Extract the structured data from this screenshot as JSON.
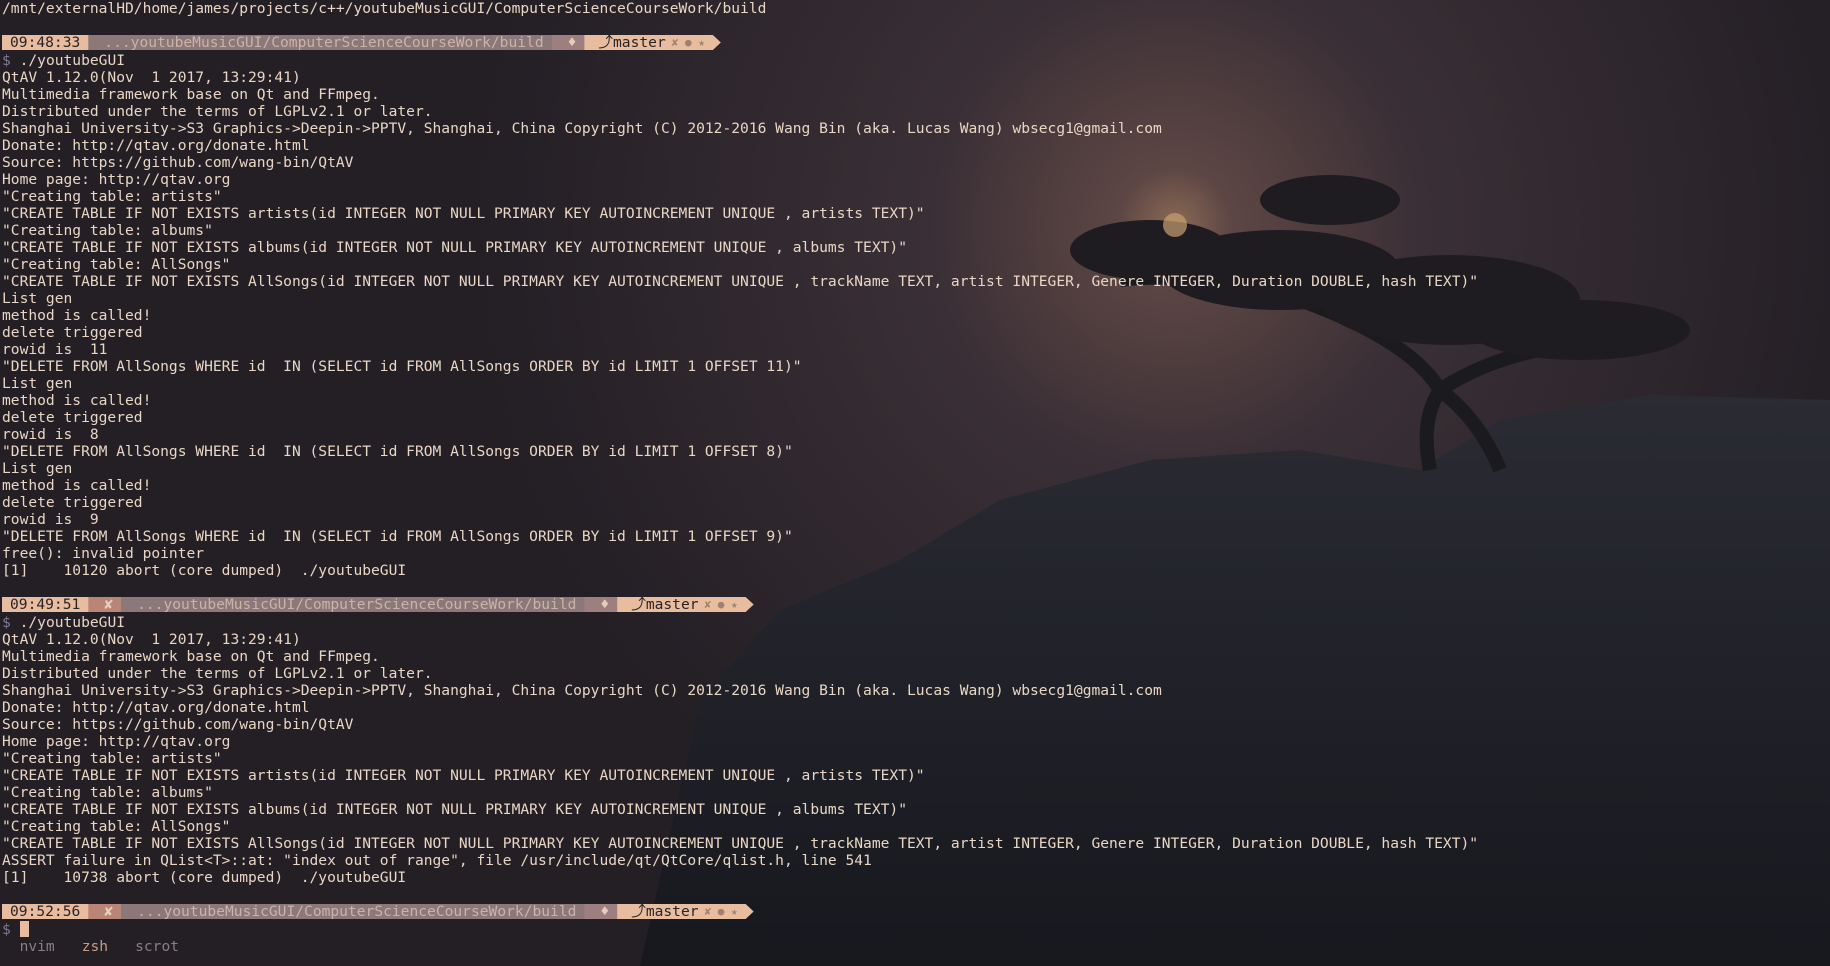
{
  "terminal": {
    "cwd_line": "/mnt/externalHD/home/james/projects/c++/youtubeMusicGUI/ComputerScienceCourseWork/build",
    "prompts": [
      {
        "time": "09:48:33",
        "error": "",
        "path": "...youtubeMusicGUI/ComputerScienceCourseWork/build",
        "dirty": "♦",
        "branch_icon": "⤴",
        "branch": "master",
        "git_status": "✘ ● ★",
        "command": "./youtubeGUI"
      },
      {
        "time": "09:49:51",
        "error": "✘",
        "path": "...youtubeMusicGUI/ComputerScienceCourseWork/build",
        "dirty": "♦",
        "branch_icon": "⤴",
        "branch": "master",
        "git_status": "✘ ● ★",
        "command": "./youtubeGUI"
      },
      {
        "time": "09:52:56",
        "error": "✘",
        "path": "...youtubeMusicGUI/ComputerScienceCourseWork/build",
        "dirty": "♦",
        "branch_icon": "⤴",
        "branch": "master",
        "git_status": "✘ ● ★",
        "command": ""
      }
    ],
    "prompt_symbol": "$",
    "outputs": [
      [
        "QtAV 1.12.0(Nov  1 2017, 13:29:41)",
        "Multimedia framework base on Qt and FFmpeg.",
        "Distributed under the terms of LGPLv2.1 or later.",
        "Shanghai University->S3 Graphics->Deepin->PPTV, Shanghai, China Copyright (C) 2012-2016 Wang Bin (aka. Lucas Wang) wbsecg1@gmail.com",
        "Donate: http://qtav.org/donate.html",
        "Source: https://github.com/wang-bin/QtAV",
        "Home page: http://qtav.org",
        "\"Creating table: artists\"",
        "\"CREATE TABLE IF NOT EXISTS artists(id INTEGER NOT NULL PRIMARY KEY AUTOINCREMENT UNIQUE , artists TEXT)\"",
        "\"Creating table: albums\"",
        "\"CREATE TABLE IF NOT EXISTS albums(id INTEGER NOT NULL PRIMARY KEY AUTOINCREMENT UNIQUE , albums TEXT)\"",
        "\"Creating table: AllSongs\"",
        "\"CREATE TABLE IF NOT EXISTS AllSongs(id INTEGER NOT NULL PRIMARY KEY AUTOINCREMENT UNIQUE , trackName TEXT, artist INTEGER, Genere INTEGER, Duration DOUBLE, hash TEXT)\"",
        "List gen",
        "method is called!",
        "delete triggered",
        "rowid is  11",
        "\"DELETE FROM AllSongs WHERE id  IN (SELECT id FROM AllSongs ORDER BY id LIMIT 1 OFFSET 11)\"",
        "List gen",
        "method is called!",
        "delete triggered",
        "rowid is  8",
        "\"DELETE FROM AllSongs WHERE id  IN (SELECT id FROM AllSongs ORDER BY id LIMIT 1 OFFSET 8)\"",
        "List gen",
        "method is called!",
        "delete triggered",
        "rowid is  9",
        "\"DELETE FROM AllSongs WHERE id  IN (SELECT id FROM AllSongs ORDER BY id LIMIT 1 OFFSET 9)\"",
        "free(): invalid pointer",
        "[1]    10120 abort (core dumped)  ./youtubeGUI"
      ],
      [
        "QtAV 1.12.0(Nov  1 2017, 13:29:41)",
        "Multimedia framework base on Qt and FFmpeg.",
        "Distributed under the terms of LGPLv2.1 or later.",
        "Shanghai University->S3 Graphics->Deepin->PPTV, Shanghai, China Copyright (C) 2012-2016 Wang Bin (aka. Lucas Wang) wbsecg1@gmail.com",
        "Donate: http://qtav.org/donate.html",
        "Source: https://github.com/wang-bin/QtAV",
        "Home page: http://qtav.org",
        "\"Creating table: artists\"",
        "\"CREATE TABLE IF NOT EXISTS artists(id INTEGER NOT NULL PRIMARY KEY AUTOINCREMENT UNIQUE , artists TEXT)\"",
        "\"Creating table: albums\"",
        "\"CREATE TABLE IF NOT EXISTS albums(id INTEGER NOT NULL PRIMARY KEY AUTOINCREMENT UNIQUE , albums TEXT)\"",
        "\"Creating table: AllSongs\"",
        "\"CREATE TABLE IF NOT EXISTS AllSongs(id INTEGER NOT NULL PRIMARY KEY AUTOINCREMENT UNIQUE , trackName TEXT, artist INTEGER, Genere INTEGER, Duration DOUBLE, hash TEXT)\"",
        "ASSERT failure in QList<T>::at: \"index out of range\", file /usr/include/qt/QtCore/qlist.h, line 541",
        "[1]    10738 abort (core dumped)  ./youtubeGUI"
      ]
    ]
  },
  "tmux_status": {
    "windows": [
      {
        "label": "nvim",
        "active": false
      },
      {
        "label": "zsh",
        "active": true
      },
      {
        "label": "scrot",
        "active": false
      }
    ]
  },
  "colors": {
    "text": "#e9d6c4",
    "segment_peach": "#e8bc9e",
    "segment_mauve": "#8c7779",
    "background": "#231f24"
  }
}
